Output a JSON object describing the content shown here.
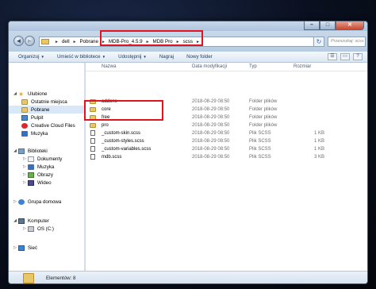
{
  "window": {
    "controls": {
      "minimize": "–",
      "maximize": "□",
      "close": "✕"
    }
  },
  "address": {
    "back": "◄",
    "forward": "►",
    "crumbs": [
      "dell",
      "Pobrane",
      "MDB-Pro_4.5.9",
      "MDB Pro",
      "scss"
    ],
    "refresh": "↻",
    "search_placeholder": "Przeszukaj: scss"
  },
  "toolbar": {
    "organize": "Organizuj",
    "include_library": "Umieść w bibliotece",
    "share": "Udostępnij",
    "burn": "Nagraj",
    "new_folder": "Nowy folder"
  },
  "nav": {
    "favorites": "Ulubione",
    "recent": "Ostatnie miejsca",
    "downloads": "Pobrane",
    "desktop": "Pulpit",
    "creative_cloud": "Creative Cloud Files",
    "music_fav": "Muzyka",
    "libraries": "Biblioteki",
    "documents": "Dokumenty",
    "music": "Muzyka",
    "pictures": "Obrazy",
    "videos": "Wideo",
    "homegroup": "Grupa domowa",
    "computer": "Komputer",
    "os_drive": "OS (C:)",
    "network": "Sieć"
  },
  "columns": {
    "name": "Nazwa",
    "date": "Data modyfikacji",
    "type": "Typ",
    "size": "Rozmiar"
  },
  "files": [
    {
      "name": "addons",
      "date": "2018-08-29 08:50",
      "type": "Folder plików",
      "size": "",
      "kind": "folder"
    },
    {
      "name": "core",
      "date": "2018-08-29 08:50",
      "type": "Folder plików",
      "size": "",
      "kind": "folder"
    },
    {
      "name": "free",
      "date": "2018-08-29 08:50",
      "type": "Folder plików",
      "size": "",
      "kind": "folder"
    },
    {
      "name": "pro",
      "date": "2018-08-29 08:50",
      "type": "Folder plików",
      "size": "",
      "kind": "folder"
    },
    {
      "name": "_custom-skin.scss",
      "date": "2018-08-29 08:50",
      "type": "Plik SCSS",
      "size": "1 KB",
      "kind": "file"
    },
    {
      "name": "_custom-styles.scss",
      "date": "2018-08-29 08:50",
      "type": "Plik SCSS",
      "size": "1 KB",
      "kind": "file"
    },
    {
      "name": "_custom-variables.scss",
      "date": "2018-08-29 08:50",
      "type": "Plik SCSS",
      "size": "1 KB",
      "kind": "file"
    },
    {
      "name": "mdb.scss",
      "date": "2018-08-29 08:50",
      "type": "Plik SCSS",
      "size": "3 KB",
      "kind": "file"
    }
  ],
  "status": {
    "items_count": "Elementów: 8"
  }
}
